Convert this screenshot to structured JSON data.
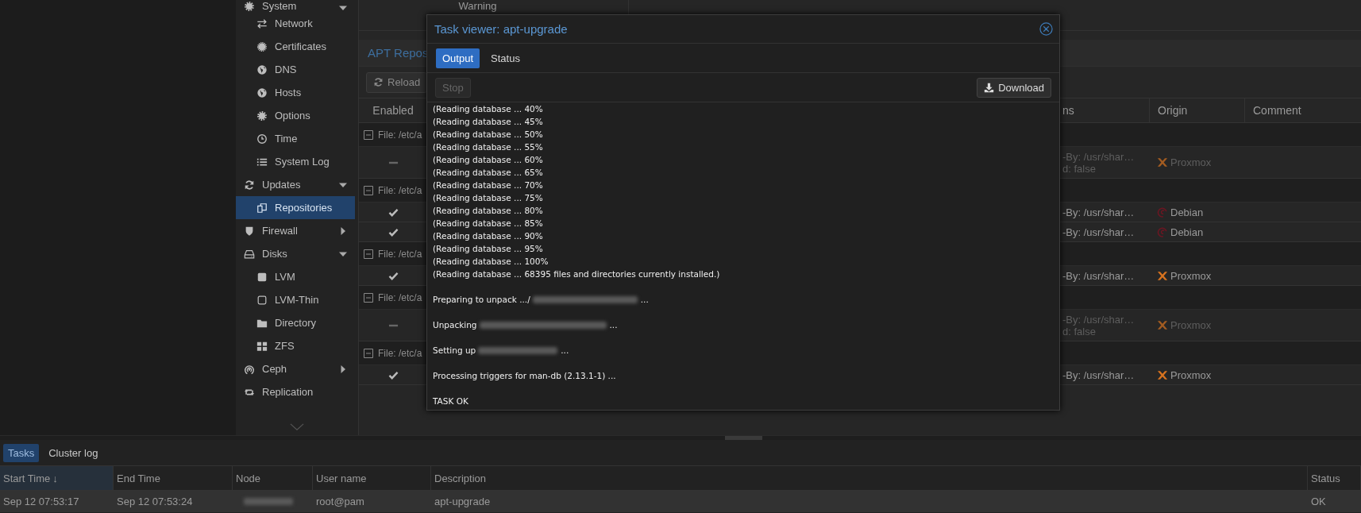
{
  "sidebar": {
    "items": [
      {
        "label": "System",
        "selected": false,
        "expanded": true,
        "children": [
          {
            "label": "Network",
            "selected": false
          },
          {
            "label": "Certificates",
            "selected": false
          },
          {
            "label": "DNS",
            "selected": false
          },
          {
            "label": "Hosts",
            "selected": false
          },
          {
            "label": "Options",
            "selected": false
          },
          {
            "label": "Time",
            "selected": false
          },
          {
            "label": "System Log",
            "selected": false
          }
        ]
      },
      {
        "label": "Updates",
        "selected": false,
        "expanded": true,
        "children": [
          {
            "label": "Repositories",
            "selected": true
          }
        ]
      },
      {
        "label": "Firewall",
        "selected": false,
        "expanded": false
      },
      {
        "label": "Disks",
        "selected": false,
        "expanded": true,
        "children": [
          {
            "label": "LVM",
            "selected": false
          },
          {
            "label": "LVM-Thin",
            "selected": false
          },
          {
            "label": "Directory",
            "selected": false
          },
          {
            "label": "ZFS",
            "selected": false
          }
        ]
      },
      {
        "label": "Ceph",
        "selected": false,
        "expanded": false
      },
      {
        "label": "Replication",
        "selected": false
      }
    ]
  },
  "panel": {
    "warning": "Warning",
    "title": "APT Repos",
    "reload_button": "Reload",
    "columns": [
      "Enabled",
      "ns",
      "Origin",
      "Comment"
    ],
    "groups": [
      {
        "file": "File: /etc/a",
        "rows": [
          {
            "enabled": false,
            "options": [
              "-By: /usr/shar…",
              "d: false"
            ],
            "origin": "Proxmox",
            "kind": "proxmox"
          }
        ]
      },
      {
        "file": "File: /etc/a",
        "rows": [
          {
            "enabled": true,
            "options": [
              "-By: /usr/shar…"
            ],
            "origin": "Debian",
            "kind": "debian"
          },
          {
            "enabled": true,
            "options": [
              "-By: /usr/shar…"
            ],
            "origin": "Debian",
            "kind": "debian"
          }
        ]
      },
      {
        "file": "File: /etc/a",
        "rows": [
          {
            "enabled": true,
            "options": [
              "-By: /usr/shar…"
            ],
            "origin": "Proxmox",
            "kind": "proxmox"
          }
        ]
      },
      {
        "file": "File: /etc/a",
        "rows": [
          {
            "enabled": false,
            "options": [
              "-By: /usr/shar…",
              "d: false"
            ],
            "origin": "Proxmox",
            "kind": "proxmox"
          }
        ]
      },
      {
        "file": "File: /etc/a",
        "rows": [
          {
            "enabled": true,
            "options": [
              "-By: /usr/shar…"
            ],
            "origin": "Proxmox",
            "kind": "proxmox"
          }
        ]
      }
    ]
  },
  "dialog": {
    "title": "Task viewer: apt-upgrade",
    "tabs": [
      {
        "label": "Output",
        "selected": true
      },
      {
        "label": "Status",
        "selected": false
      }
    ],
    "stop_button": {
      "label": "Stop",
      "disabled": true
    },
    "download_button": "Download",
    "log": [
      {
        "text": "(Reading database ... 40%"
      },
      {
        "text": "(Reading database ... 45%"
      },
      {
        "text": "(Reading database ... 50%"
      },
      {
        "text": "(Reading database ... 55%"
      },
      {
        "text": "(Reading database ... 60%"
      },
      {
        "text": "(Reading database ... 65%"
      },
      {
        "text": "(Reading database ... 70%"
      },
      {
        "text": "(Reading database ... 75%"
      },
      {
        "text": "(Reading database ... 80%"
      },
      {
        "text": "(Reading database ... 85%"
      },
      {
        "text": "(Reading database ... 90%"
      },
      {
        "text": "(Reading database ... 95%"
      },
      {
        "text": "(Reading database ... 100%"
      },
      {
        "text": "(Reading database ... 68395 files and directories currently installed.)"
      },
      {
        "text": "Preparing to unpack .../",
        "gap_before": true,
        "redacted": true,
        "after": "..."
      },
      {
        "text": "Unpacking",
        "gap_before": true,
        "redacted": true,
        "after": "..."
      },
      {
        "text": "Setting up",
        "gap_before": true,
        "redacted": true,
        "after": "..."
      },
      {
        "text": "Processing triggers for man-db (2.13.1-1) ...",
        "gap_before": true
      },
      {
        "text": "TASK OK",
        "gap_before": true
      }
    ]
  },
  "bottom_panel": {
    "tabs": [
      {
        "label": "Tasks",
        "selected": true
      },
      {
        "label": "Cluster log",
        "selected": false
      }
    ],
    "columns": [
      {
        "label": "Start Time",
        "sort_arrow": "↓"
      },
      {
        "label": "End Time"
      },
      {
        "label": "Node"
      },
      {
        "label": "User name"
      },
      {
        "label": "Description"
      },
      {
        "label": "Status"
      }
    ],
    "rows": [
      {
        "start_time": "Sep 12 07:53:17",
        "end_time": "Sep 12 07:53:24",
        "node_redacted": true,
        "user": "root@pam",
        "description": "apt-upgrade",
        "status": "OK"
      }
    ]
  }
}
